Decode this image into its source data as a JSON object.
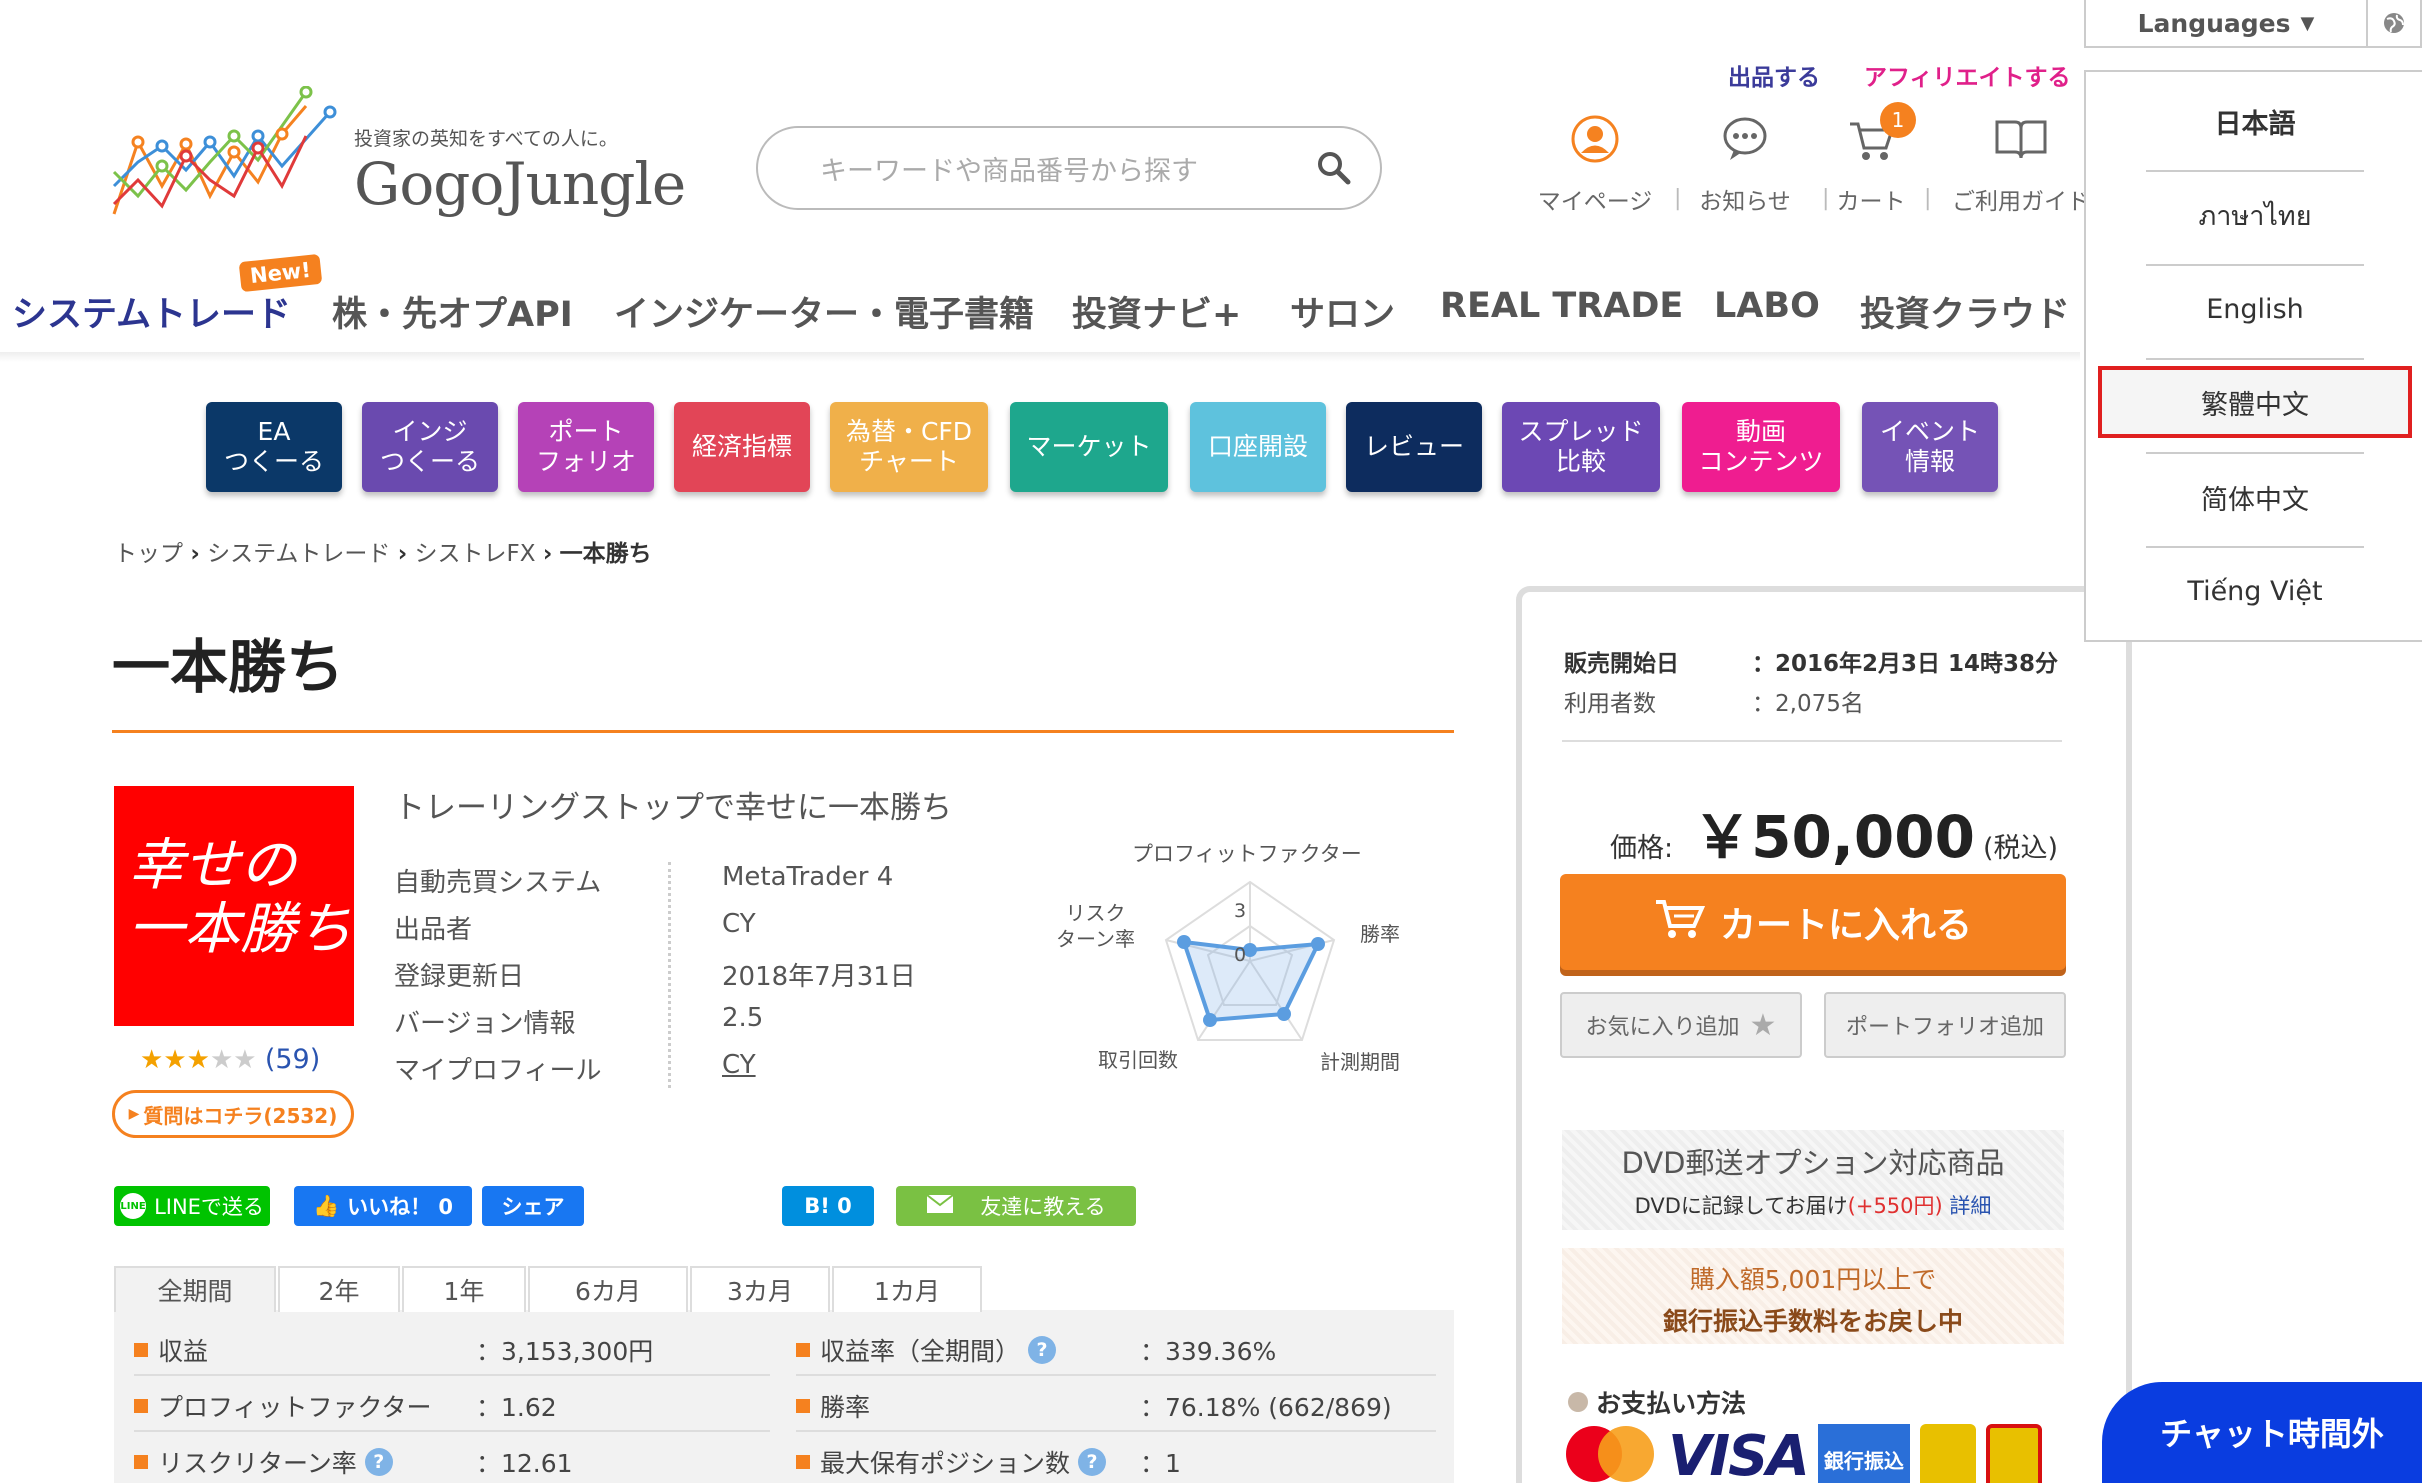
{
  "header": {
    "sell_link": "出品する",
    "affiliate_link": "アフィリエイトする",
    "logo_tagline": "投資家の英知をすべての人に。",
    "logo_name": "GogoJungle",
    "search_placeholder": "キーワードや商品番号から探す",
    "icons": [
      {
        "label": "マイページ"
      },
      {
        "label": "お知らせ"
      },
      {
        "label": "カート",
        "badge": "1"
      },
      {
        "label": "ご利用ガイド"
      }
    ],
    "separator": "|"
  },
  "nav": {
    "new_badge": "New!",
    "items": [
      "システムトレード",
      "株・先オプAPI",
      "インジケーター・電子書籍",
      "投資ナビ+",
      "サロン",
      "REAL TRADE",
      "LABO",
      "投資クラウド"
    ]
  },
  "tiles": [
    {
      "line1": "EA",
      "line2": "つくーる",
      "color": "#0b3868"
    },
    {
      "line1": "インジ",
      "line2": "つくーる",
      "color": "#6a4aaf"
    },
    {
      "line1": "ポート",
      "line2": "フォリオ",
      "color": "#b542b7"
    },
    {
      "line1": "経済指標",
      "line2": "",
      "color": "#e24557"
    },
    {
      "line1": "為替・CFD",
      "line2": "チャート",
      "color": "#f0b04a"
    },
    {
      "line1": "マーケット",
      "line2": "",
      "color": "#1ea78d"
    },
    {
      "line1": "口座開設",
      "line2": "",
      "color": "#5ec2dd"
    },
    {
      "line1": "レビュー",
      "line2": "",
      "color": "#0d2c5e"
    },
    {
      "line1": "スプレッド",
      "line2": "比較",
      "color": "#6c48b4"
    },
    {
      "line1": "動画",
      "line2": "コンテンツ",
      "color": "#ef1d90"
    },
    {
      "line1": "イベント",
      "line2": "情報",
      "color": "#7553b6"
    }
  ],
  "breadcrumb": {
    "items": [
      "トップ",
      "システムトレード",
      "シストレFX"
    ],
    "current": "一本勝ち",
    "sep": "›"
  },
  "product": {
    "title": "一本勝ち",
    "image_line1": "幸せの",
    "image_line2": "一本勝ち",
    "rating_count": "(59)",
    "question_button": "質問はコチラ(2532)",
    "subtitle": "トレーリングストップで幸せに一本勝ち",
    "specs": [
      {
        "label": "自動売買システム",
        "value": "MetaTrader 4"
      },
      {
        "label": "出品者",
        "value": "CY"
      },
      {
        "label": "登録更新日",
        "value": "2018年7月31日"
      },
      {
        "label": "バージョン情報",
        "value": "2.5"
      },
      {
        "label": "マイプロフィール",
        "value": "CY"
      }
    ],
    "radar": {
      "labels": [
        "プロフィットファクター",
        "勝率",
        "計測期間",
        "取引回数",
        "リスク\nターン率"
      ],
      "scale_max": "3",
      "scale_zero": "0"
    }
  },
  "share": {
    "line": "LINEで送る",
    "like": "いいね！ 0",
    "share": "シェア",
    "hatena": "B! 0",
    "mail": "友達に教える"
  },
  "tabs": [
    "全期間",
    "2年",
    "1年",
    "6カ月",
    "3カ月",
    "1カ月"
  ],
  "stats": [
    {
      "label": "収益",
      "value": "：3,153,300円",
      "help": false
    },
    {
      "label": "収益率（全期間）",
      "value": "：339.36%",
      "help": true
    },
    {
      "label": "プロフィットファクター",
      "value": "：1.62",
      "help": false
    },
    {
      "label": "勝率",
      "value": "：76.18% (662/869)",
      "help": false
    },
    {
      "label": "リスクリターン率",
      "value": "：12.61",
      "help": true
    },
    {
      "label": "最大保有ポジション数",
      "value": "：1",
      "help": true
    }
  ],
  "side": {
    "sale_start_label": "販売開始日",
    "sale_start_value": "：2016年2月3日 14時38分",
    "users_label": "利用者数",
    "users_value": "：2,075名",
    "price_label": "価格:",
    "price": "￥50,000",
    "tax": "(税込)",
    "cart_button": "カートに入れる",
    "favorite_button": "お気に入り追加",
    "portfolio_button": "ポートフォリオ追加",
    "dvd_title": "DVD郵送オプション対応商品",
    "dvd_desc": "DVDに記録してお届け",
    "dvd_price": "(+550円)",
    "dvd_link": "詳細",
    "bank_line1": "購入額5,001円以上で",
    "bank_line2": "銀行振込手数料をお戻し中",
    "payment_title": "お支払い方法",
    "visa": "VISA",
    "bank_badge": "銀行振込"
  },
  "languages": {
    "button": "Languages",
    "items": [
      "日本語",
      "ภาษาไทย",
      "English",
      "繁體中文",
      "简体中文",
      "Tiếng Việt"
    ],
    "highlighted": "繁體中文"
  },
  "chat": {
    "label": "チャット時間外"
  }
}
